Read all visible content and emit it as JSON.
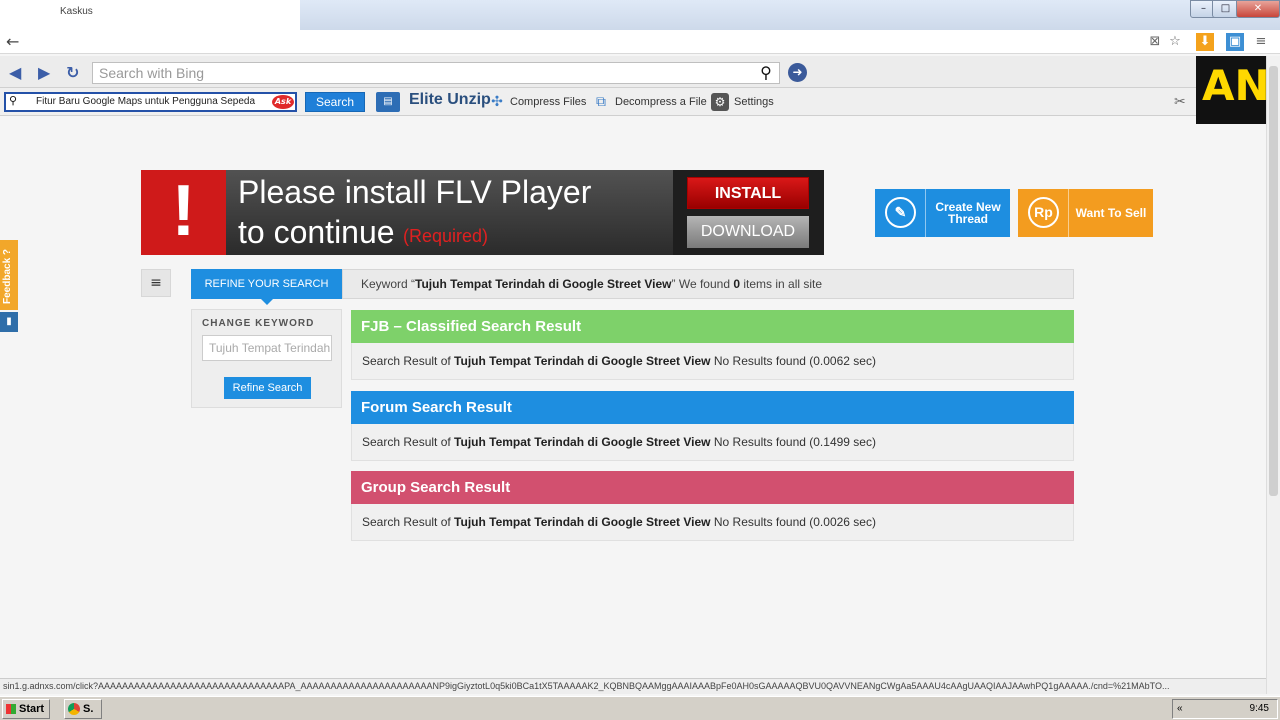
{
  "window": {
    "tab_title": "Kaskus",
    "controls": {
      "minimize": "–",
      "maximize": "□",
      "close": "✕"
    }
  },
  "ask_toolbar": {
    "bing_placeholder": "Search with Bing",
    "ask_query": "Fitur Baru Google Maps untuk Pengguna Sepeda",
    "ask_logo": "Ask",
    "search_label": "Search",
    "elite_unzip": "Elite Unzip",
    "compress": "Compress Files",
    "decompress": "Decompress a File",
    "settings": "Settings"
  },
  "corner_ad": {
    "text": "AN"
  },
  "ad_banner": {
    "line1": "Please install FLV Player",
    "line2": "to continue",
    "required": "(Required)",
    "install": "INSTALL",
    "download": "DOWNLOAD"
  },
  "cta": {
    "thread_label": "Create New Thread",
    "sell_label": "Want To Sell",
    "sell_icon": "Rp"
  },
  "search": {
    "refine_tab": "REFINE YOUR SEARCH",
    "keyword_prefix": "Keyword “",
    "keyword": "Tujuh Tempat Terindah di Google Street View",
    "keyword_mid": "” We found ",
    "count": "0",
    "keyword_suffix": " items in all site",
    "change_keyword": "CHANGE KEYWORD",
    "input_value": "Tujuh Tempat Terindah di Google Street View",
    "refine_button": "Refine Search"
  },
  "results": [
    {
      "title": "FJB – Classified Search Result",
      "color": "#7ed16a",
      "prefix": "Search Result of ",
      "query": "Tujuh Tempat Terindah di Google Street View",
      "status": " No Results found (0.0062 sec)"
    },
    {
      "title": "Forum Search Result",
      "color": "#1e8ee0",
      "prefix": "Search Result of ",
      "query": "Tujuh Tempat Terindah di Google Street View",
      "status": "No Results found (0.1499 sec)"
    },
    {
      "title": "Group Search Result",
      "color": "#d2506f",
      "prefix": "Search Result of ",
      "query": "Tujuh Tempat Terindah di Google Street View",
      "status": "No Results found (0.0026 sec)"
    }
  ],
  "feedback": {
    "label": "Feedback ?"
  },
  "statusbar": {
    "url": "sin1.g.adnxs.com/click?AAAAAAAAAAAAAAAAAAAAAAAAAAAAAAAPA_AAAAAAAAAAAAAAAAAAAAAANP9igGiyztotL0q5ki0BCa1tX5TAAAAAK2_KQBNBQAAMggAAAIAAABpFe0AH0sGAAAAAQBVU0QAVVNEANgCWgAa5AAAU4cAAgUAAQIAAJAAwhPQ1gAAAAA./cnd=%21MAbTO..."
  },
  "taskbar": {
    "start": "Start",
    "task": "S.",
    "time": "9:45"
  }
}
